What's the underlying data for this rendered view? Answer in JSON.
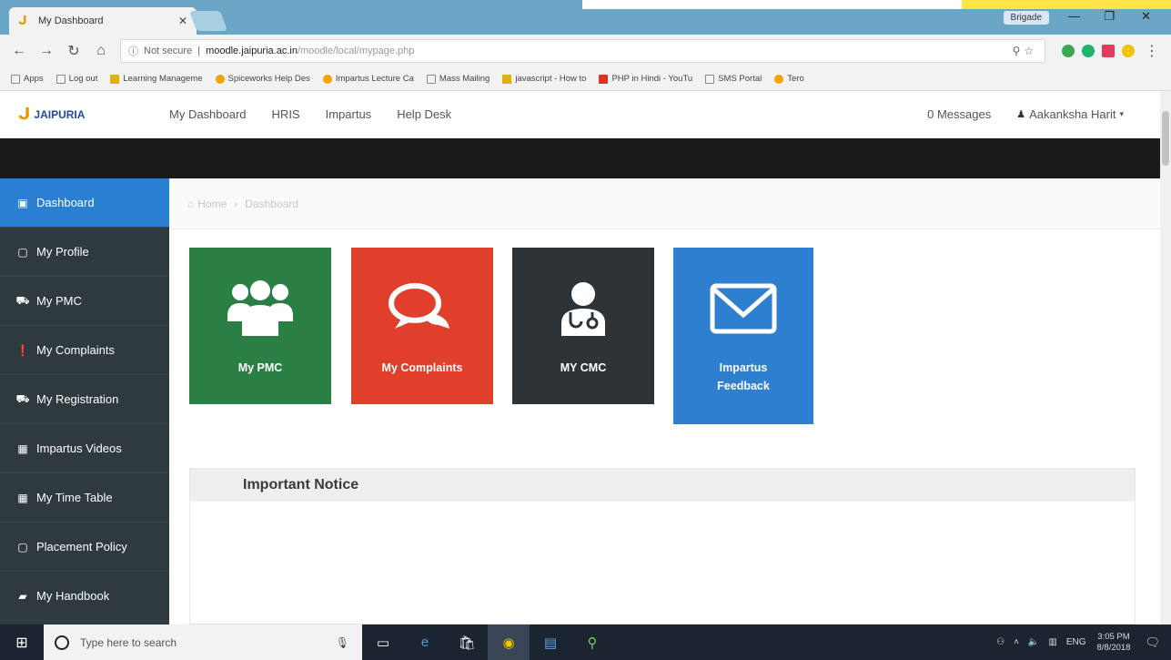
{
  "browser": {
    "tab_title": "My Dashboard",
    "profile_name": "Brigade",
    "url_security": "Not secure",
    "url_domain": "moodle.jaipuria.ac.in",
    "url_path": "/moodle/local/mypage.php",
    "bookmarks": [
      "Apps",
      "Log out",
      "Learning Manageme",
      "Spiceworks Help Des",
      "Impartus Lecture Ca",
      "Mass Mailing",
      "javascript - How to",
      "PHP in Hindi - YouTu",
      "SMS Portal",
      "Tero"
    ]
  },
  "site": {
    "logo_text": "JAIPURIA",
    "nav": [
      "My Dashboard",
      "HRIS",
      "Impartus",
      "Help Desk"
    ],
    "messages": "0 Messages",
    "user": "Aakanksha Harit"
  },
  "sidebar": {
    "items": [
      {
        "label": "Dashboard",
        "icon": "picture-icon"
      },
      {
        "label": "My Profile",
        "icon": "file-icon"
      },
      {
        "label": "My PMC",
        "icon": "car-icon"
      },
      {
        "label": "My Complaints",
        "icon": "exclamation-icon"
      },
      {
        "label": "My Registration",
        "icon": "car-icon"
      },
      {
        "label": "Impartus Videos",
        "icon": "calendar-icon"
      },
      {
        "label": "My Time Table",
        "icon": "calendar-icon"
      },
      {
        "label": "Placement Policy",
        "icon": "file-icon"
      },
      {
        "label": "My Handbook",
        "icon": "book-icon"
      }
    ]
  },
  "breadcrumb": {
    "home": "Home",
    "current": "Dashboard"
  },
  "tiles": [
    {
      "label": "My PMC",
      "icon": "users-icon",
      "color": "#2a7f45"
    },
    {
      "label": "My Complaints",
      "icon": "chat-bubbles-icon",
      "color": "#e0402b"
    },
    {
      "label": "MY CMC",
      "icon": "doctor-icon",
      "color": "#2d3337"
    },
    {
      "label": "Impartus Feedback",
      "icon": "envelope-icon",
      "color": "#2e7fcf"
    }
  ],
  "notice": {
    "title": "Important Notice"
  },
  "taskbar": {
    "search_placeholder": "Type here to search",
    "language": "ENG",
    "time": "3:05 PM",
    "date": "8/8/2018"
  }
}
